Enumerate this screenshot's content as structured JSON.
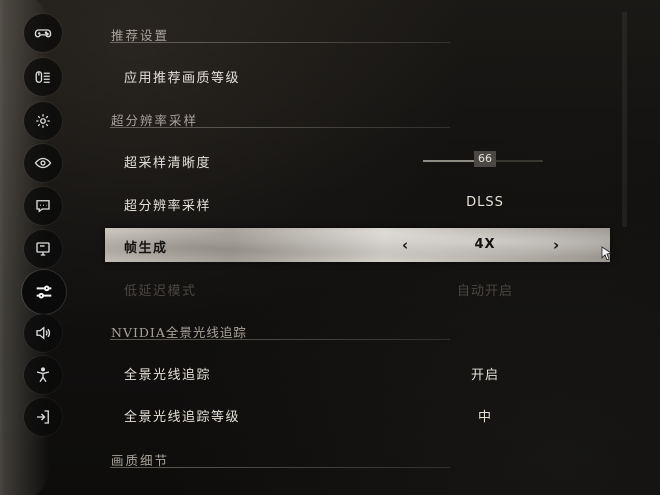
{
  "sidebar": {
    "items": [
      {
        "icon": "gamepad-icon"
      },
      {
        "icon": "keyboard-mouse-icon"
      },
      {
        "icon": "gear-icon"
      },
      {
        "icon": "eye-icon"
      },
      {
        "icon": "subtitle-icon"
      },
      {
        "icon": "monitor-icon"
      },
      {
        "icon": "sliders-icon",
        "active": true
      },
      {
        "icon": "speaker-icon"
      },
      {
        "icon": "accessibility-icon"
      },
      {
        "icon": "exit-icon"
      }
    ]
  },
  "sections": {
    "recommended": {
      "title": "推荐设置",
      "rows": {
        "apply_preset": {
          "label": "应用推荐画质等级"
        }
      }
    },
    "upscaling": {
      "title": "超分辨率采样",
      "rows": {
        "sharpness": {
          "label": "超采样清晰度",
          "value": "66",
          "fill": 0.55
        },
        "upscaler": {
          "label": "超分辨率采样",
          "value": "DLSS"
        },
        "frame_gen": {
          "label": "帧生成",
          "value": "4X",
          "prev": "‹",
          "next": "›"
        },
        "low_latency": {
          "label": "低延迟模式",
          "value": "自动开启"
        }
      }
    },
    "raytracing": {
      "title": "NVIDIA全景光线追踪",
      "rows": {
        "pathtracing": {
          "label": "全景光线追踪",
          "value": "开启"
        },
        "pathtracing_level": {
          "label": "全景光线追踪等级",
          "value": "中"
        }
      }
    },
    "details": {
      "title": "画质细节"
    }
  },
  "colors": {
    "text": "#e4e0d8",
    "section": "#a9a39a",
    "disabled": "#4a4641",
    "selected_bg": "#c9c5bd"
  }
}
